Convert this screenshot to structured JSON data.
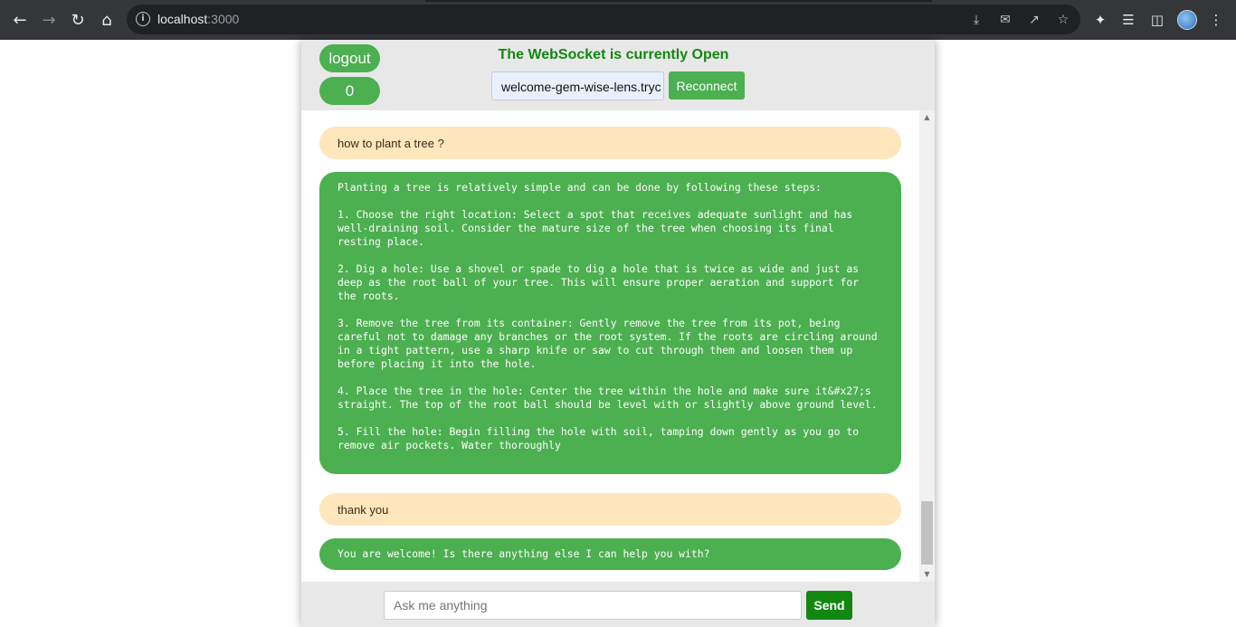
{
  "browser": {
    "url_host": "localhost",
    "url_port": ":3000"
  },
  "header": {
    "logout_label": "logout",
    "counter_value": "0",
    "status_text": "The WebSocket is currently Open",
    "session_name": "welcome-gem-wise-lens.tryc",
    "reconnect_label": "Reconnect"
  },
  "messages": [
    {
      "role": "user",
      "text": "how to plant a tree ?"
    },
    {
      "role": "bot",
      "text": "Planting a tree is relatively simple and can be done by following these steps:\n\n1. Choose the right location: Select a spot that receives adequate sunlight and has well-draining soil. Consider the mature size of the tree when choosing its final resting place.\n\n2. Dig a hole: Use a shovel or spade to dig a hole that is twice as wide and just as deep as the root ball of your tree. This will ensure proper aeration and support for the roots.\n\n3. Remove the tree from its container: Gently remove the tree from its pot, being careful not to damage any branches or the root system. If the roots are circling around in a tight pattern, use a sharp knife or saw to cut through them and loosen them up before placing it into the hole.\n\n4. Place the tree in the hole: Center the tree within the hole and make sure it&#x27;s straight. The top of the root ball should be level with or slightly above ground level.\n\n5. Fill the hole: Begin filling the hole with soil, tamping down gently as you go to remove air pockets. Water thoroughly"
    },
    {
      "role": "user",
      "text": "thank you"
    },
    {
      "role": "bot",
      "text": "You are welcome! Is there anything else I can help you with?"
    }
  ],
  "composer": {
    "placeholder": "Ask me anything",
    "send_label": "Send"
  },
  "colors": {
    "accent_green": "#4caf50",
    "status_green": "#128712",
    "user_bubble": "#ffe6bd"
  }
}
